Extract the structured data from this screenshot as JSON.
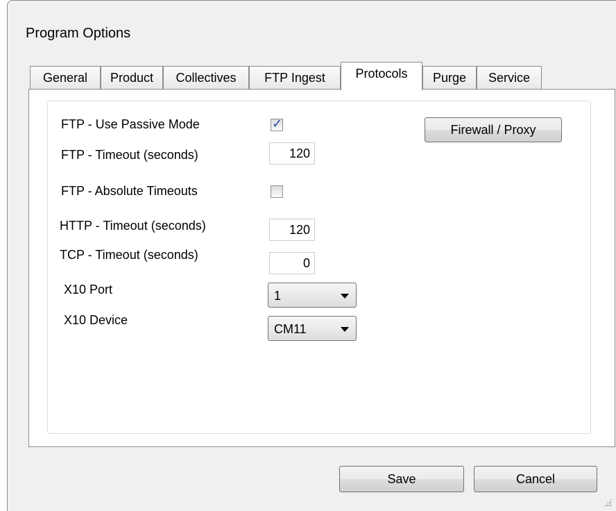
{
  "window": {
    "title": "Program Options"
  },
  "tabs": [
    {
      "label": "General"
    },
    {
      "label": "Product"
    },
    {
      "label": "Collectives"
    },
    {
      "label": "FTP Ingest"
    },
    {
      "label": "Protocols"
    },
    {
      "label": "Purge"
    },
    {
      "label": "Service"
    }
  ],
  "active_tab": "Protocols",
  "protocols": {
    "ftp_passive": {
      "label": "FTP - Use Passive Mode",
      "checked": true
    },
    "ftp_timeout": {
      "label": "FTP - Timeout (seconds)",
      "value": "120"
    },
    "ftp_absolute": {
      "label": "FTP - Absolute Timeouts",
      "checked": false
    },
    "http_timeout": {
      "label": "HTTP - Timeout (seconds)",
      "value": "120"
    },
    "tcp_timeout": {
      "label": "TCP - Timeout (seconds)",
      "value": "0"
    },
    "x10_port": {
      "label": "X10 Port",
      "selected": "1"
    },
    "x10_device": {
      "label": "X10 Device",
      "selected": "CM11"
    },
    "firewall_button": "Firewall / Proxy"
  },
  "footer": {
    "save_label": "Save",
    "cancel_label": "Cancel"
  }
}
